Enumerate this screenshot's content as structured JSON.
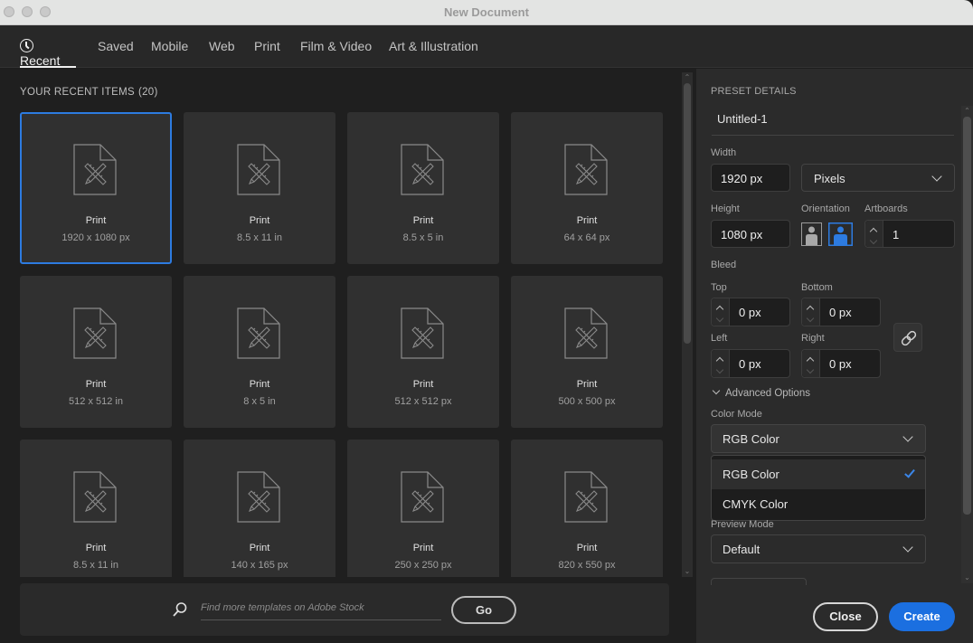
{
  "window": {
    "title": "New Document"
  },
  "tabs": [
    {
      "label": "Recent",
      "icon": "clock-icon",
      "active": true
    },
    {
      "label": "Saved"
    },
    {
      "label": "Mobile"
    },
    {
      "label": "Web"
    },
    {
      "label": "Print"
    },
    {
      "label": "Film & Video"
    },
    {
      "label": "Art & Illustration"
    }
  ],
  "recent": {
    "heading": "YOUR RECENT ITEMS",
    "count": "(20)",
    "items": [
      {
        "name": "Print",
        "size": "1920 x 1080 px",
        "selected": true
      },
      {
        "name": "Print",
        "size": "8.5 x 11 in"
      },
      {
        "name": "Print",
        "size": "8.5 x 5 in"
      },
      {
        "name": "Print",
        "size": "64 x 64 px"
      },
      {
        "name": "Print",
        "size": "512 x 512 in"
      },
      {
        "name": "Print",
        "size": "8 x 5 in"
      },
      {
        "name": "Print",
        "size": "512 x 512 px"
      },
      {
        "name": "Print",
        "size": "500 x 500 px"
      },
      {
        "name": "Print",
        "size": "8.5 x 11 in"
      },
      {
        "name": "Print",
        "size": "140 x 165 px"
      },
      {
        "name": "Print",
        "size": "250 x 250 px"
      },
      {
        "name": "Print",
        "size": "820 x 550 px"
      }
    ]
  },
  "stock": {
    "placeholder": "Find more templates on Adobe Stock",
    "go_label": "Go"
  },
  "preset": {
    "heading": "PRESET DETAILS",
    "doc_name": "Untitled-1",
    "width_label": "Width",
    "width_value": "1920 px",
    "units_value": "Pixels",
    "height_label": "Height",
    "height_value": "1080 px",
    "orientation_label": "Orientation",
    "orientation_selected": "landscape",
    "artboards_label": "Artboards",
    "artboards_value": "1",
    "bleed_label": "Bleed",
    "bleed": {
      "top_label": "Top",
      "top_value": "0 px",
      "bottom_label": "Bottom",
      "bottom_value": "0 px",
      "left_label": "Left",
      "left_value": "0 px",
      "right_label": "Right",
      "right_value": "0 px"
    },
    "advanced_label": "Advanced Options",
    "color_mode_label": "Color Mode",
    "color_mode_value": "RGB Color",
    "color_mode_options": [
      {
        "label": "RGB Color",
        "selected": true
      },
      {
        "label": "CMYK Color"
      }
    ],
    "preview_mode_label": "Preview Mode",
    "preview_mode_value": "Default"
  },
  "actions": {
    "close_label": "Close",
    "create_label": "Create"
  },
  "colors": {
    "accent": "#1b6fe0",
    "selection_border": "#2d7be0",
    "check": "#3b86e8"
  }
}
